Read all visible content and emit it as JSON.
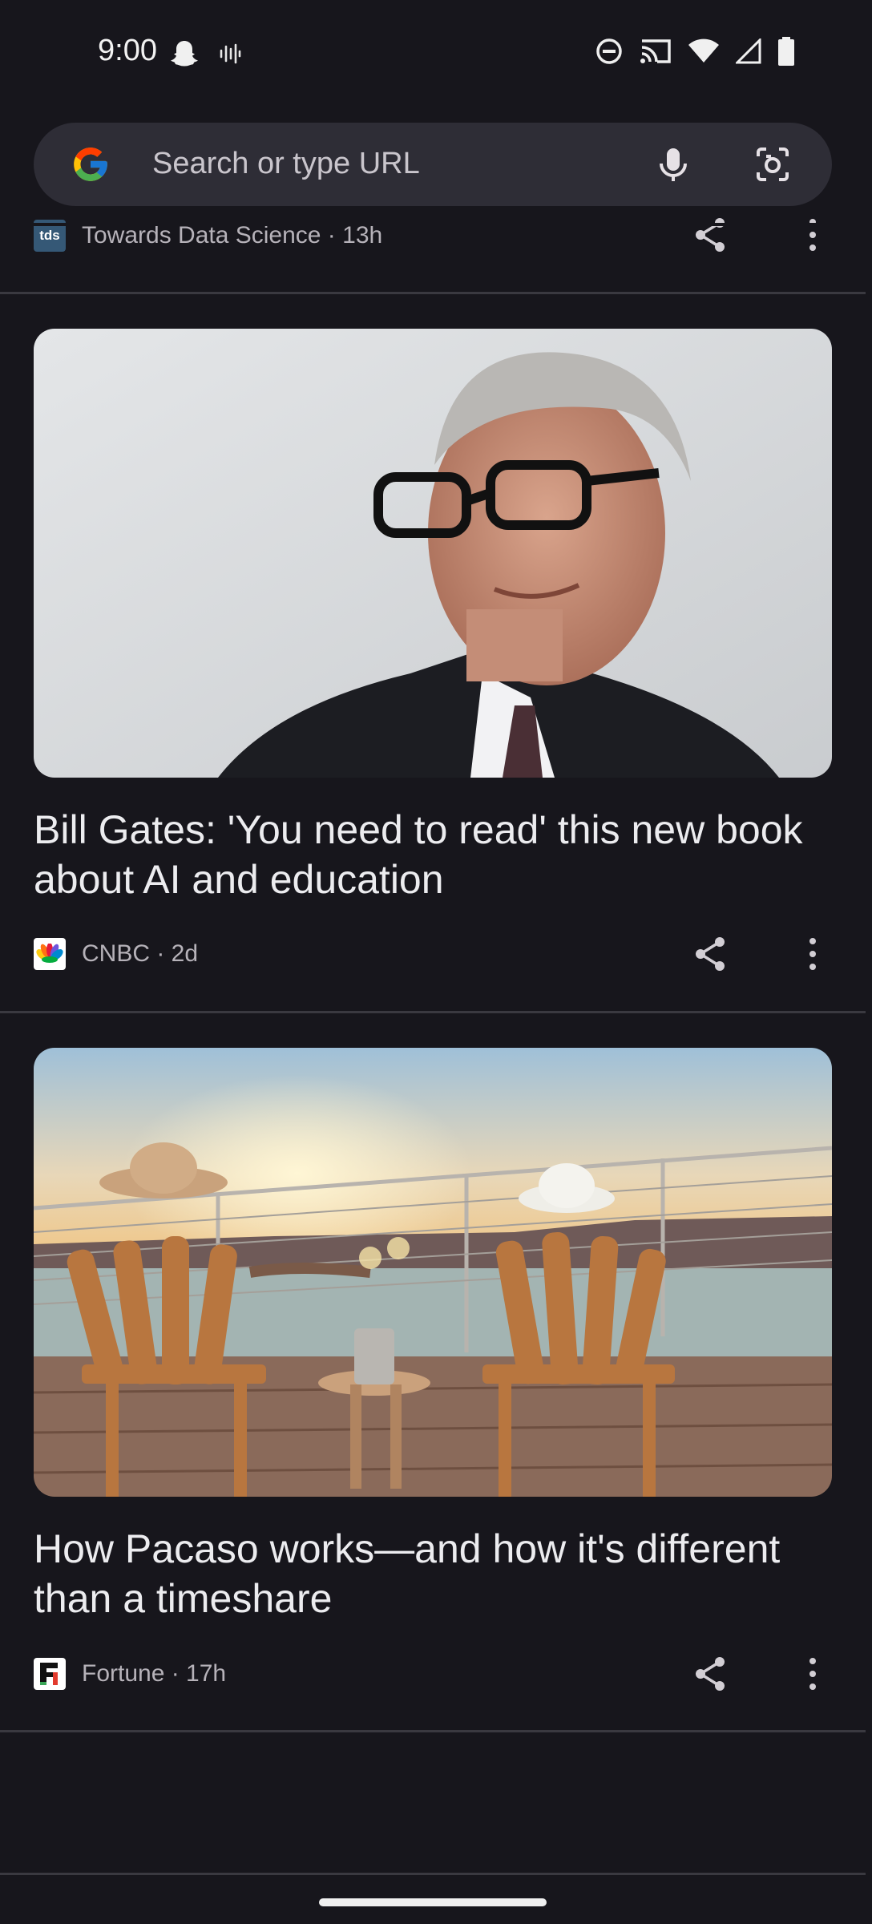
{
  "status_bar": {
    "time": "9:00",
    "left_icons": [
      "snapchat-icon",
      "sound-wave-icon"
    ],
    "right_icons": [
      "do-not-disturb-icon",
      "cast-icon",
      "wifi-icon",
      "signal-icon",
      "battery-icon"
    ]
  },
  "search": {
    "placeholder": "Search or type URL",
    "icons": [
      "google-logo-icon",
      "microphone-icon",
      "google-lens-icon"
    ]
  },
  "feed": {
    "items": [
      {
        "source": "Towards Data Science · 13h",
        "logo_text": "tds",
        "logo_color": "#355876"
      },
      {
        "headline": "Bill Gates: 'You need to read' this new book about AI and education",
        "source": "CNBC · 2d",
        "image_subject": "portrait-photo"
      },
      {
        "headline": "How Pacaso works—and how it's different than a timeshare",
        "source": "Fortune · 17h",
        "image_subject": "sunset-deck-photo"
      }
    ]
  },
  "colors": {
    "background": "#17161c",
    "search_bar": "#2e2d36",
    "divider": "#3a3940"
  }
}
